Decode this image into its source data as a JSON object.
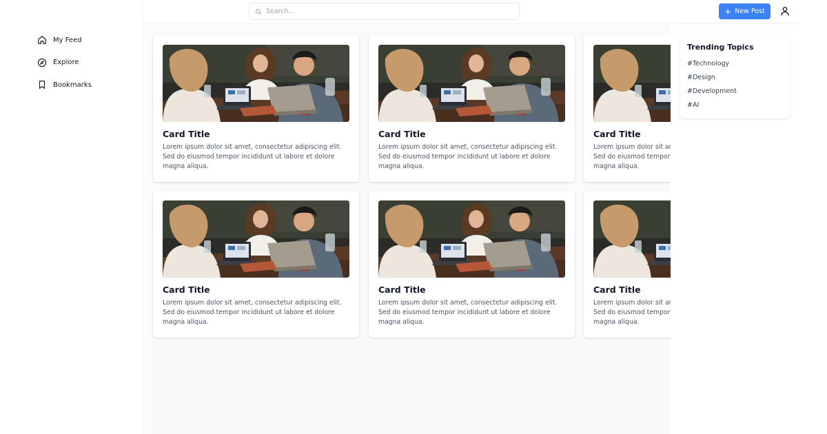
{
  "sidebar": {
    "items": [
      {
        "label": "My Feed",
        "icon": "home-icon"
      },
      {
        "label": "Explore",
        "icon": "compass-icon"
      },
      {
        "label": "Bookmarks",
        "icon": "bookmark-icon"
      }
    ]
  },
  "header": {
    "search_placeholder": "Search...",
    "new_post_label": "New Post",
    "user_icon": "user-icon"
  },
  "cards": [
    {
      "title": "Card Title",
      "text": "Lorem ipsum dolor sit amet, consectetur adipiscing elit. Sed do eiusmod tempor incididunt ut labore et dolore magna aliqua.",
      "image": "people-at-laptops-photo"
    },
    {
      "title": "Card Title",
      "text": "Lorem ipsum dolor sit amet, consectetur adipiscing elit. Sed do eiusmod tempor incididunt ut labore et dolore magna aliqua.",
      "image": "people-at-laptops-photo"
    },
    {
      "title": "Card Title",
      "text": "Lorem ipsum dolor sit amet, consectetur adipiscing elit. Sed do eiusmod tempor incididunt ut labore et dolore magna aliqua.",
      "image": "people-at-laptops-photo"
    },
    {
      "title": "Card Title",
      "text": "Lorem ipsum dolor sit amet, consectetur adipiscing elit. Sed do eiusmod tempor incididunt ut labore et dolore magna aliqua.",
      "image": "people-at-laptops-photo"
    },
    {
      "title": "Card Title",
      "text": "Lorem ipsum dolor sit amet, consectetur adipiscing elit. Sed do eiusmod tempor incididunt ut labore et dolore magna aliqua.",
      "image": "people-at-laptops-photo"
    },
    {
      "title": "Card Title",
      "text": "Lorem ipsum dolor sit amet, consectetur adipiscing elit. Sed do eiusmod tempor incididunt ut labore et dolore magna aliqua.",
      "image": "people-at-laptops-photo"
    }
  ],
  "trending": {
    "title": "Trending Topics",
    "topics": [
      "#Technology",
      "#Design",
      "#Development",
      "#AI"
    ]
  },
  "colors": {
    "accent": "#3b82f6",
    "main_bg": "#f9fafb",
    "text": "#111827",
    "muted_text": "#4b5563"
  }
}
